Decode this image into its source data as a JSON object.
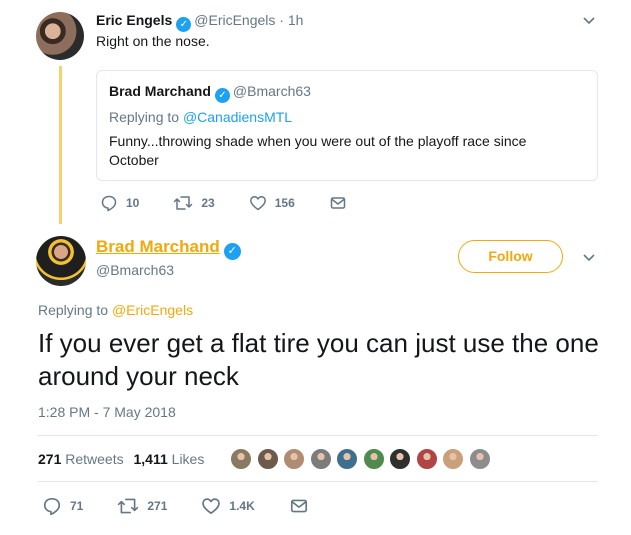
{
  "quoting_tweet": {
    "name": "Eric Engels",
    "handle": "@EricEngels",
    "separator": "·",
    "time": "1h",
    "text": "Right on the nose."
  },
  "quoted_tweet": {
    "name": "Brad Marchand",
    "handle": "@Bmarch63",
    "replying_prefix": "Replying to",
    "replying_to": "@CanadiensMTL",
    "text": "Funny...throwing shade when you were out of the playoff race since October"
  },
  "top_actions": {
    "replies": "10",
    "retweets": "23",
    "likes": "156"
  },
  "main_tweet": {
    "name": "Brad Marchand",
    "handle": "@Bmarch63",
    "follow_label": "Follow",
    "replying_prefix": "Replying to",
    "replying_to": "@EricEngels",
    "text": "If you ever get a flat tire you can just use the one around your neck",
    "timestamp": "1:28 PM - 7 May 2018",
    "retweet_count": "271",
    "retweet_label": "Retweets",
    "like_count": "1,411",
    "like_label": "Likes"
  },
  "bottom_actions": {
    "replies": "71",
    "retweets": "271",
    "likes": "1.4K"
  },
  "colors": {
    "accent_gold": "#f3a80b",
    "twitter_blue": "#1da1f2",
    "muted": "#657786",
    "thread_line": "#f5d36c"
  },
  "liker_colors": [
    "#8a7a63",
    "#6e5a4a",
    "#b08c73",
    "#7c7c7c",
    "#3f6f8f",
    "#4f8a4f",
    "#2f2f2f",
    "#b04545",
    "#c9a07a",
    "#8d8d8d"
  ]
}
